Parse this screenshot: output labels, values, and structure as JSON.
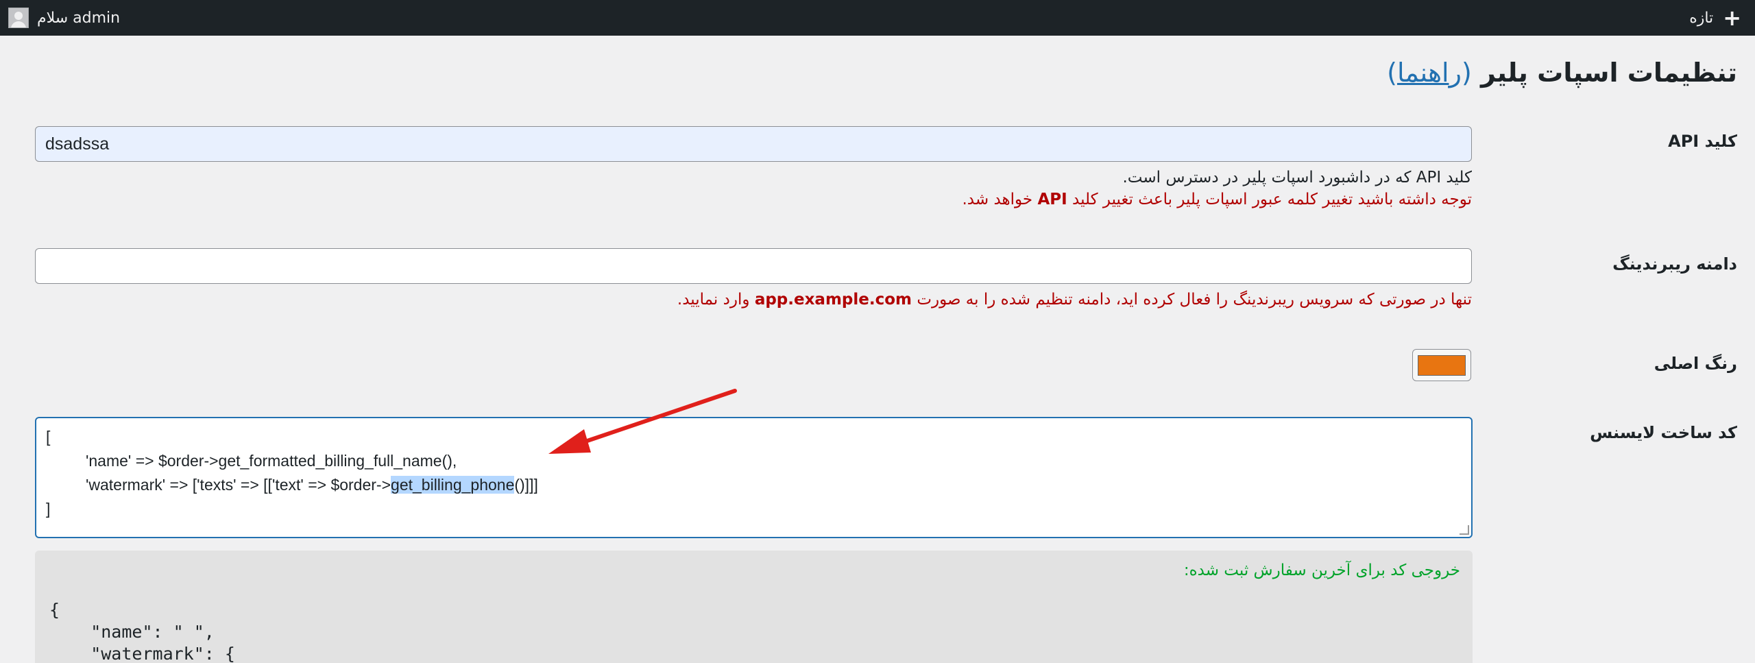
{
  "admin_bar": {
    "greeting": "سلام admin",
    "new_label": "تازه",
    "new_icon": "plus-icon"
  },
  "page": {
    "title": "تنظیمات اسپات پلیر",
    "guide_link": "راهنما"
  },
  "api_key": {
    "label": "کلید API",
    "value": "dsadssa",
    "description": "کلید API که در داشبورد اسپات پلیر در دسترس است.",
    "warning_prefix": "توجه داشته باشید تغییر کلمه عبور اسپات پلیر باعث تغییر کلید",
    "warning_bold": "API",
    "warning_suffix": "خواهد شد."
  },
  "rebranding_domain": {
    "label": "دامنه ریبرندینگ",
    "value": "",
    "description_prefix": "تنها در صورتی که سرویس ریبرندینگ را فعال کرده اید، دامنه تنظیم شده را به صورت",
    "description_bold": "app.example.com",
    "description_suffix": "وارد نمایید."
  },
  "main_color": {
    "label": "رنگ اصلی",
    "value": "#e87511"
  },
  "license_code": {
    "label": "کد ساخت لایسنس",
    "line1": "[",
    "line2": "'name' => $order->get_formatted_billing_full_name(),",
    "line3_before": "'watermark' => ['texts' => [['text' => $order->",
    "line3_highlight": "get_billing_phone",
    "line3_after": "()]]]",
    "line4": "]"
  },
  "output": {
    "label": "خروجی کد برای آخرین سفارش ثبت شده:",
    "line1": "{",
    "line2": "    \"name\": \" \",",
    "line3": "    \"watermark\": {"
  },
  "colors": {
    "admin_bar_bg": "#1d2327",
    "accent": "#2271b1",
    "warning": "#b00000",
    "success": "#00a32a",
    "arrow": "#e0201b"
  }
}
